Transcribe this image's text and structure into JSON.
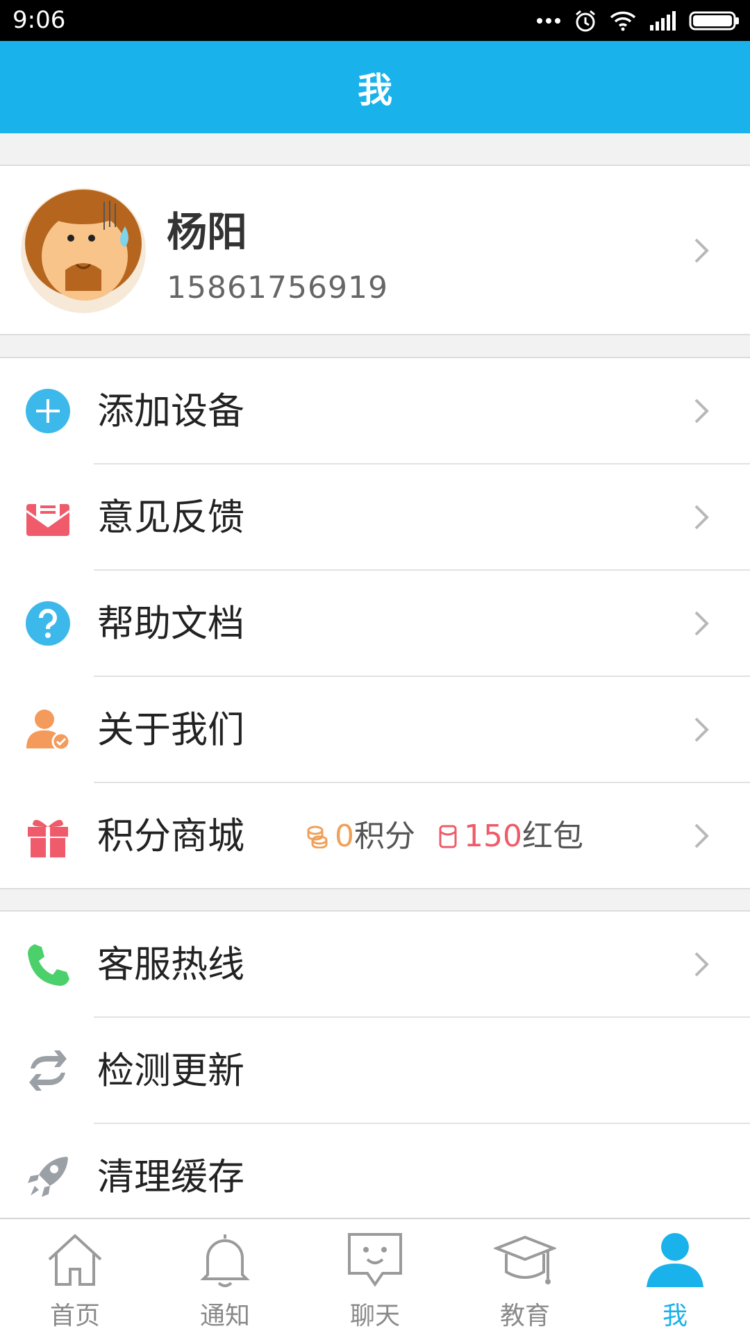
{
  "status_bar": {
    "time": "9:06"
  },
  "header": {
    "title": "我"
  },
  "profile": {
    "name": "杨阳",
    "phone": "15861756919"
  },
  "menu_group_1": [
    {
      "label": "添加设备",
      "icon": "add-icon",
      "color": "#3db8ea"
    },
    {
      "label": "意见反馈",
      "icon": "mail-icon",
      "color": "#ef5b6a"
    },
    {
      "label": "帮助文档",
      "icon": "help-icon",
      "color": "#3db8ea"
    },
    {
      "label": "关于我们",
      "icon": "user-check-icon",
      "color": "#f49a5a"
    },
    {
      "label": "积分商城",
      "icon": "gift-icon",
      "color": "#ef5b6a"
    }
  ],
  "points": {
    "points_value": "0",
    "points_unit": "积分",
    "redpacket_value": "150",
    "redpacket_unit": "红包"
  },
  "menu_group_2": [
    {
      "label": "客服热线",
      "icon": "phone-icon",
      "color": "#4cd06b"
    },
    {
      "label": "检测更新",
      "icon": "refresh-icon",
      "color": "#9aa0a6"
    },
    {
      "label": "清理缓存",
      "icon": "rocket-icon",
      "color": "#9aa0a6"
    }
  ],
  "bottom_nav": [
    {
      "label": "首页",
      "icon": "home-icon"
    },
    {
      "label": "通知",
      "icon": "bell-icon"
    },
    {
      "label": "聊天",
      "icon": "chat-icon"
    },
    {
      "label": "教育",
      "icon": "graduation-cap-icon"
    },
    {
      "label": "我",
      "icon": "profile-icon",
      "active": true
    }
  ],
  "colors": {
    "accent": "#1ab2ea",
    "background": "#f2f2f2"
  }
}
